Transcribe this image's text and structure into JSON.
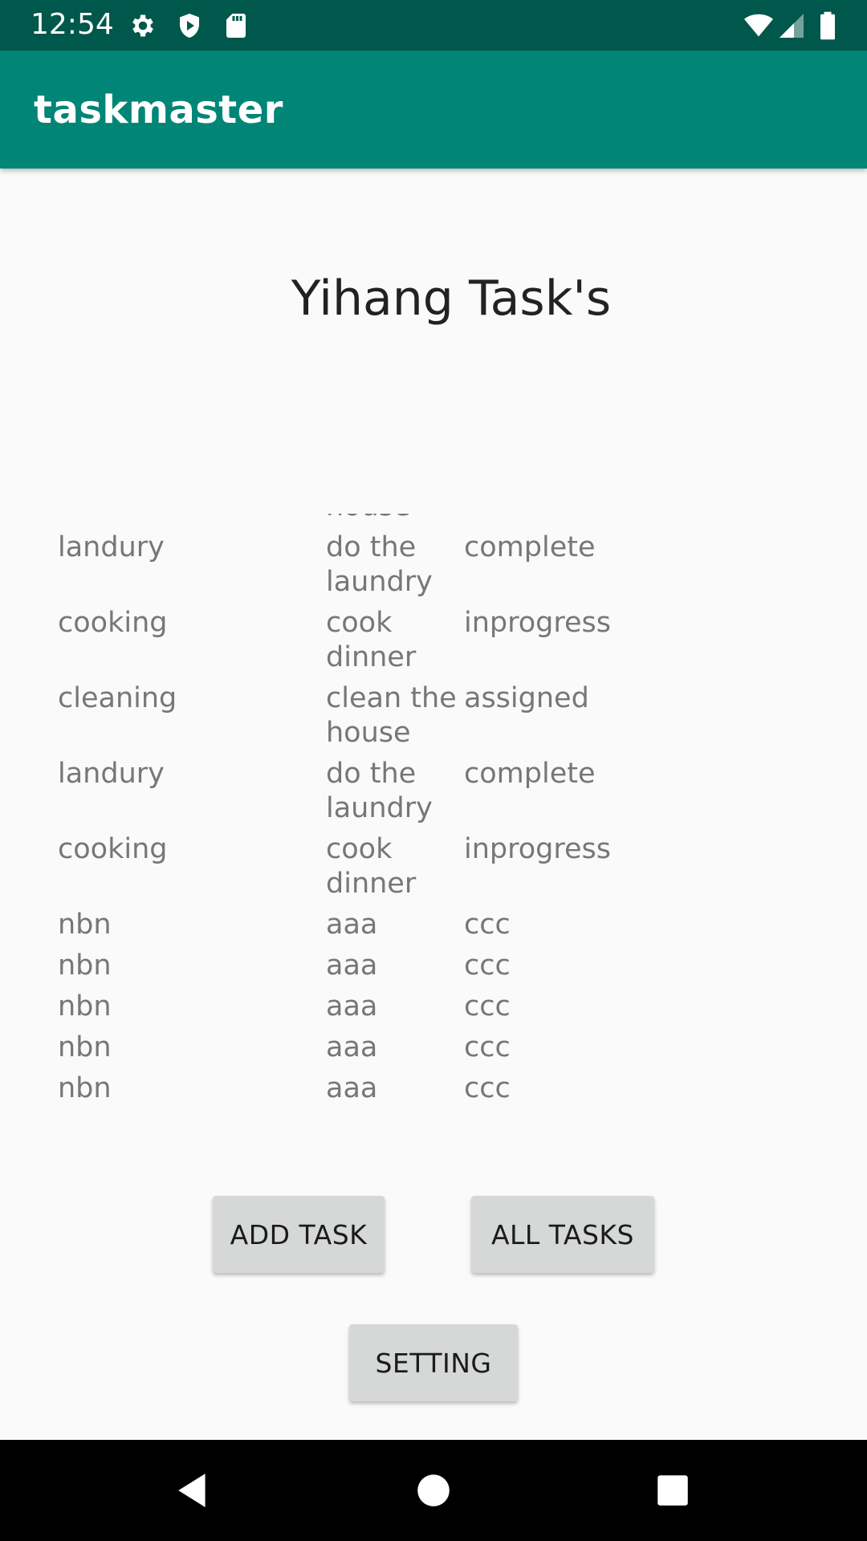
{
  "status_bar": {
    "time": "12:54",
    "icons": [
      "gear-icon",
      "shield-icon",
      "sd-card-icon",
      "wifi-icon",
      "signal-icon",
      "battery-icon"
    ]
  },
  "app_bar": {
    "title": "taskmaster",
    "color": "#008577",
    "status_color": "#00574b"
  },
  "main": {
    "title": "Yihang Task's",
    "tasks": [
      {
        "title": "",
        "body": "house",
        "state": ""
      },
      {
        "title": "landury",
        "body": "do the laundry",
        "state": "complete"
      },
      {
        "title": "cooking",
        "body": "cook dinner",
        "state": "inprogress"
      },
      {
        "title": "cleaning",
        "body": "clean the house",
        "state": "assigned"
      },
      {
        "title": "landury",
        "body": "do the laundry",
        "state": "complete"
      },
      {
        "title": "cooking",
        "body": "cook dinner",
        "state": "inprogress"
      },
      {
        "title": "nbn",
        "body": "aaa",
        "state": "ccc"
      },
      {
        "title": "nbn",
        "body": "aaa",
        "state": "ccc"
      },
      {
        "title": "nbn",
        "body": "aaa",
        "state": "ccc"
      },
      {
        "title": "nbn",
        "body": "aaa",
        "state": "ccc"
      },
      {
        "title": "nbn",
        "body": "aaa",
        "state": "ccc"
      }
    ]
  },
  "buttons": {
    "add_task": "ADD TASK",
    "all_tasks": "ALL TASKS",
    "setting": "SETTING"
  },
  "nav_bar": {
    "icons": [
      "back-icon",
      "home-icon",
      "recents-icon"
    ]
  }
}
